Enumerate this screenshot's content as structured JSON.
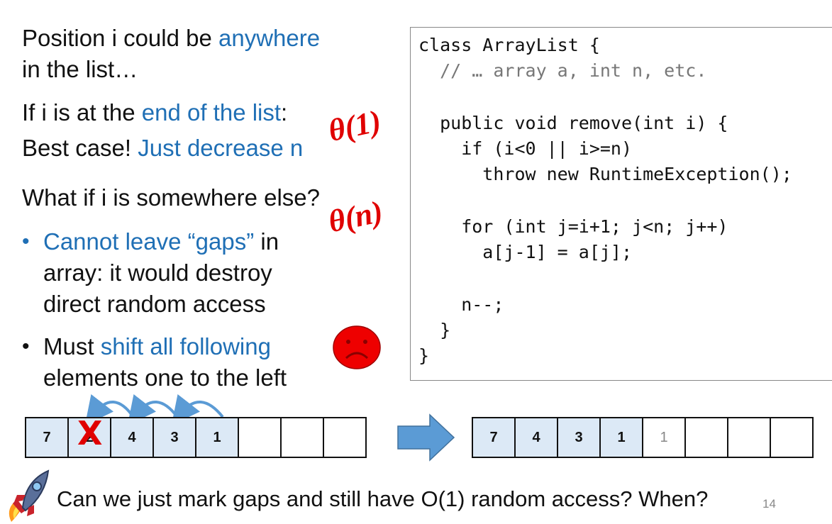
{
  "left": {
    "line1a": "Position i could be ",
    "line1b": "anywhere",
    "line2": "in the list…",
    "line3a": "If i is at the ",
    "line3b": "end of the list",
    "line3c": ":",
    "line4a": "Best case! ",
    "line4b": "Just decrease n",
    "line5": "What if i is somewhere else?",
    "bullet1a": "Cannot leave “gaps”",
    "bullet1b": " in",
    "bullet1c": "array: it would destroy",
    "bullet1d": "direct random access",
    "bullet2a": "Must ",
    "bullet2b": "shift all following",
    "bullet2c": "elements one to the left",
    "bullet_char": "•"
  },
  "theta": {
    "best": "θ(1)",
    "worst": "θ(n)"
  },
  "code": {
    "lines": [
      "class ArrayList {",
      "  // … array a, int n, etc.",
      "",
      "  public void remove(int i) {",
      "    if (i<0 || i>=n)",
      "      throw new RuntimeException();",
      "",
      "    for (int j=i+1; j<n; j++)",
      "      a[j-1] = a[j];",
      "",
      "    n--;",
      "  }",
      "}"
    ]
  },
  "before_array": [
    "7",
    "2",
    "4",
    "3",
    "1",
    "",
    "",
    ""
  ],
  "after_array": [
    "7",
    "4",
    "3",
    "1",
    "1",
    "",
    "",
    ""
  ],
  "removed_mark": "X",
  "footer": {
    "question": "Can we just mark gaps and still have O(1) random access? When?",
    "page": "14"
  },
  "colors": {
    "accent_blue": "#1f6fb5",
    "theta_red": "#e00000",
    "cell_fill": "#dce9f6",
    "arrow_blue": "#5b9bd5"
  }
}
